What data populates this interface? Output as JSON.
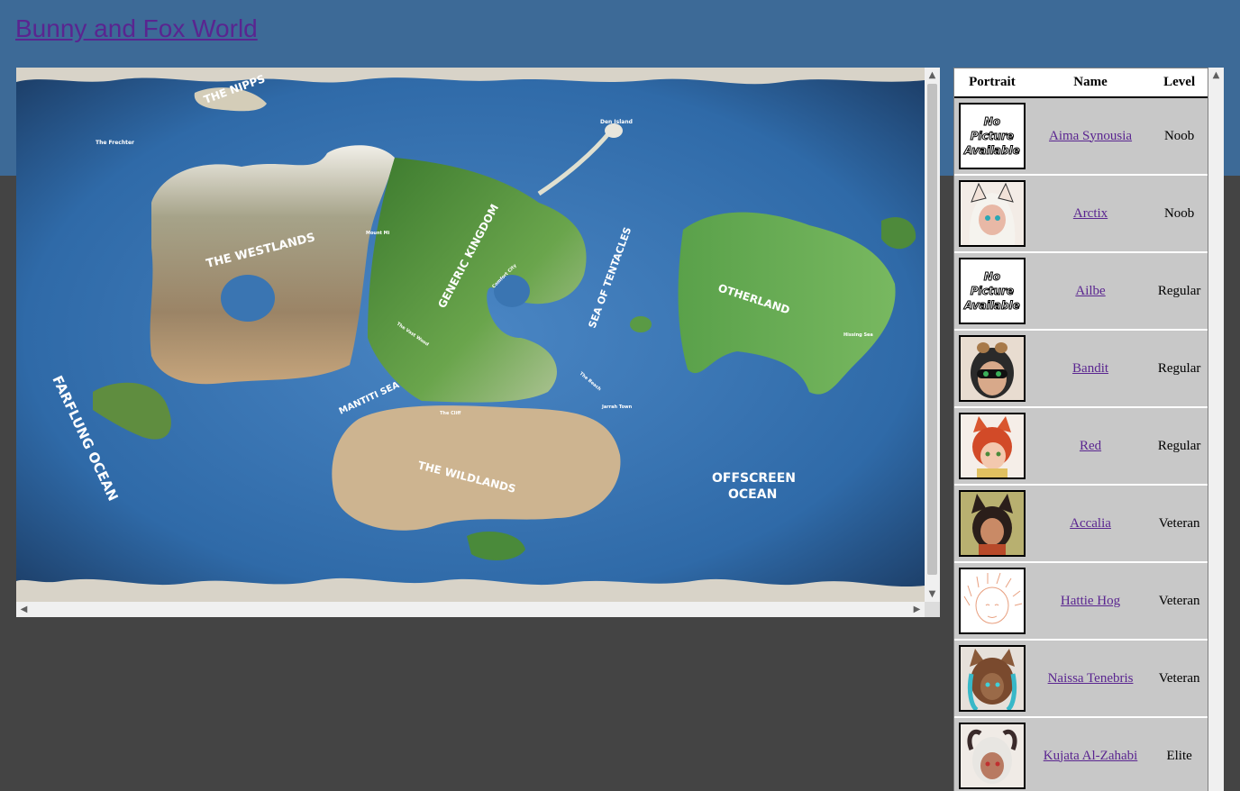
{
  "site": {
    "title": "Bunny and Fox World"
  },
  "map": {
    "labels": {
      "nipps": "THE NIPPS",
      "frechter": "The Frechter",
      "den_island": "Den Island",
      "westlands": "THE WESTLANDS",
      "generic_kingdom": "GENERIC KINGDOM",
      "sea_of_tentacles": "SEA OF TENTACLES",
      "otherland": "OTHERLAND",
      "farflung_ocean": "FARFLUNG OCEAN",
      "mantiti_sea": "MANTITI SEA",
      "wildlands": "THE WILDLANDS",
      "offscreen_ocean_1": "OFFSCREEN",
      "offscreen_ocean_2": "OCEAN",
      "mount_mi": "Mount Mi",
      "the_vast_wood": "The Vast Wood",
      "comfort_city": "Comfort City",
      "the_cliff": "The Cliff",
      "the_beach": "The Beach",
      "jarrah_town": "Jarrah Town",
      "hissing_sea": "Hissing Sea"
    }
  },
  "characters": {
    "headers": {
      "portrait": "Portrait",
      "name": "Name",
      "level": "Level"
    },
    "no_picture_text": "No Picture Available",
    "rows": [
      {
        "name": "Aima Synousia",
        "level": "Noob",
        "portrait": "no-picture"
      },
      {
        "name": "Arctix",
        "level": "Noob",
        "portrait": "avatar-white-hair-fox-ears"
      },
      {
        "name": "Ailbe",
        "level": "Regular",
        "portrait": "no-picture"
      },
      {
        "name": "Bandit",
        "level": "Regular",
        "portrait": "avatar-masked-girl-goggles"
      },
      {
        "name": "Red",
        "level": "Regular",
        "portrait": "avatar-red-hair-fox-ears"
      },
      {
        "name": "Accalia",
        "level": "Veteran",
        "portrait": "avatar-dark-wolf-ears"
      },
      {
        "name": "Hattie Hog",
        "level": "Veteran",
        "portrait": "avatar-sketch-hedgehog"
      },
      {
        "name": "Naissa Tenebris",
        "level": "Veteran",
        "portrait": "avatar-brown-cat-teal-hair"
      },
      {
        "name": "Kujata Al-Zahabi",
        "level": "Elite",
        "portrait": "avatar-white-hair-horns"
      }
    ]
  },
  "colors": {
    "header_band": "#3d6a97",
    "page_bg": "#444444",
    "link": "#5a2590",
    "ocean": "#2f6aa8",
    "forest": "#4f8a3a",
    "sand": "#c4a67a"
  }
}
